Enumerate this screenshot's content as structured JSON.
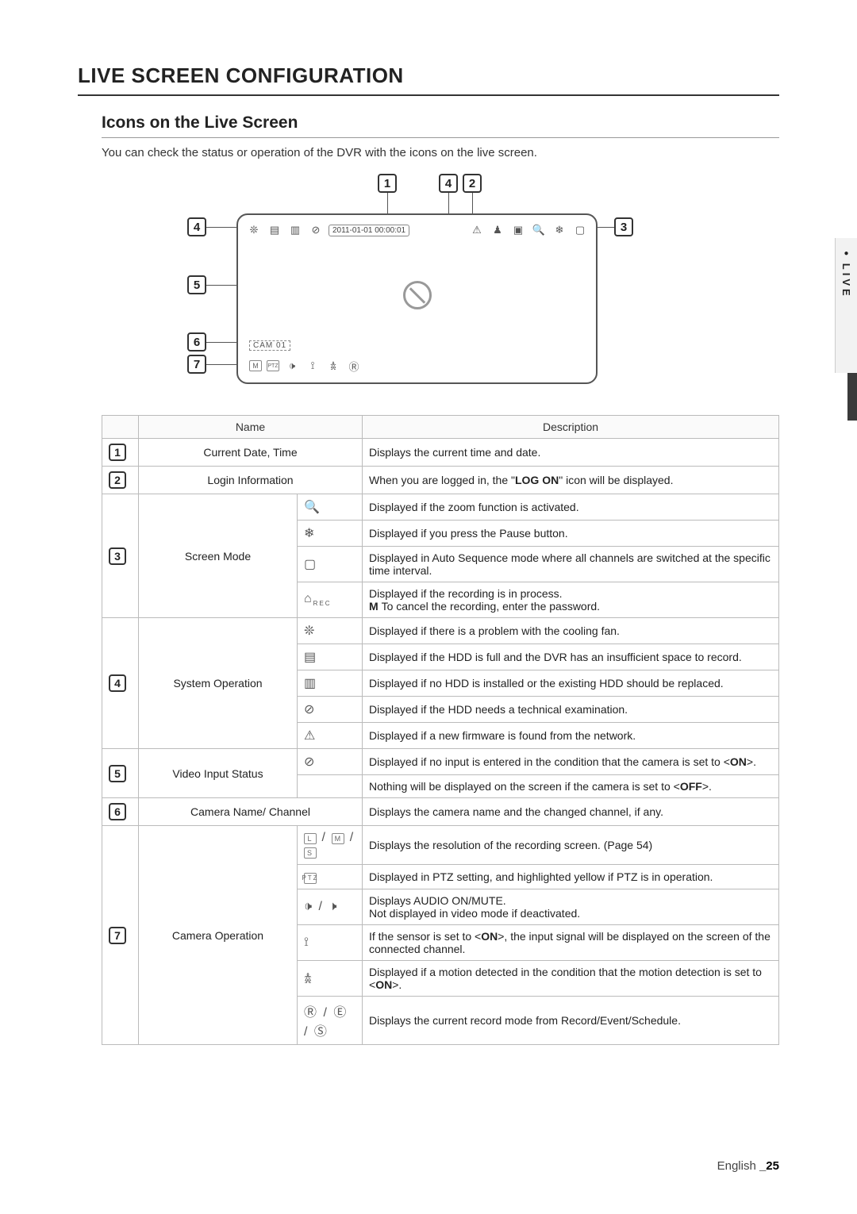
{
  "page": {
    "title": "LIVE SCREEN CONFIGURATION",
    "section": "Icons on the Live Screen",
    "intro": "You can check the status or operation of the DVR with the icons on the live screen.",
    "footer_lang": "English",
    "footer_page": "_25",
    "side_tab": "LIVE"
  },
  "diagram": {
    "date_time": "2011-01-01 00:00:01",
    "cam_label": "CAM 01",
    "callouts": [
      "1",
      "2",
      "3",
      "4",
      "5",
      "6",
      "7"
    ],
    "top_callouts": [
      "1",
      "4",
      "2"
    ],
    "left_callouts": [
      "4",
      "5",
      "6",
      "7"
    ],
    "right_callouts": [
      "3"
    ]
  },
  "table": {
    "headers": {
      "name": "Name",
      "description": "Description"
    },
    "rows": [
      {
        "num": "1",
        "name": "Current Date, Time",
        "sub": [
          {
            "icon": "",
            "desc": "Displays the current time and date."
          }
        ]
      },
      {
        "num": "2",
        "name": "Login Information",
        "sub": [
          {
            "icon": "",
            "desc_pre": "When you are logged in, the \"",
            "desc_bold": "LOG ON",
            "desc_post": "\" icon will be displayed."
          }
        ]
      },
      {
        "num": "3",
        "name": "Screen Mode",
        "sub": [
          {
            "icon": "zoom",
            "desc": "Displayed if the zoom function is activated."
          },
          {
            "icon": "pause",
            "desc": "Displayed if you press the Pause button."
          },
          {
            "icon": "autoseq",
            "desc": "Displayed in Auto Sequence mode where all channels are switched at the specific time interval."
          },
          {
            "icon": "rec",
            "desc": "Displayed if the recording is in process.",
            "note": "To cancel the recording, enter the password."
          }
        ]
      },
      {
        "num": "4",
        "name": "System Operation",
        "sub": [
          {
            "icon": "fan",
            "desc": "Displayed if there is a problem with the cooling fan."
          },
          {
            "icon": "hdd-full",
            "desc": "Displayed if the HDD is full and the DVR has an insufficient space to record."
          },
          {
            "icon": "no-hdd",
            "desc": "Displayed if no HDD is installed or the existing HDD should be replaced."
          },
          {
            "icon": "hdd-exam",
            "desc": "Displayed if the HDD needs a technical examination."
          },
          {
            "icon": "fw",
            "desc": "Displayed if a new firmware is found from the network."
          }
        ]
      },
      {
        "num": "5",
        "name": "Video Input Status",
        "sub": [
          {
            "icon": "no-input",
            "desc_pre": "Displayed if no input is entered in the condition that the camera is set to <",
            "desc_bold": "ON",
            "desc_post": ">."
          },
          {
            "icon": "",
            "desc_pre": "Nothing will be displayed on the screen if the camera is set to <",
            "desc_bold": "OFF",
            "desc_post": ">."
          }
        ]
      },
      {
        "num": "6",
        "name": "Camera Name/ Channel",
        "sub": [
          {
            "icon": "",
            "desc": "Displays the camera name and the changed channel, if any."
          }
        ]
      },
      {
        "num": "7",
        "name": "Camera Operation",
        "sub": [
          {
            "icon": "L-M-S",
            "desc": "Displays the resolution of the recording screen. (Page 54)"
          },
          {
            "icon": "ptz",
            "desc": "Displayed in PTZ setting, and highlighted yellow if PTZ is in operation."
          },
          {
            "icon": "audio",
            "desc": "Displays AUDIO ON/MUTE.\nNot displayed in video mode if deactivated."
          },
          {
            "icon": "sensor",
            "desc_pre": "If the sensor is set to <",
            "desc_bold": "ON",
            "desc_post": ">, the input signal will be displayed on the screen of the connected channel."
          },
          {
            "icon": "motion",
            "desc_pre": "Displayed if a motion detected in the condition that the motion detection is set to <",
            "desc_bold": "ON",
            "desc_post": ">."
          },
          {
            "icon": "R-E-S",
            "desc": "Displays the current record mode from Record/Event/Schedule."
          }
        ]
      }
    ]
  }
}
